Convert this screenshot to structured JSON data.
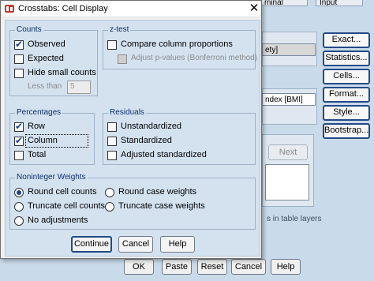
{
  "background": {
    "tabs": [
      "minal",
      "Input"
    ],
    "var_field_top": "ety]",
    "var_field_bottom": "ndex [BMI]",
    "side_buttons": [
      "Exact...",
      "Statistics...",
      "Cells...",
      "Format...",
      "Style...",
      "Bootstrap..."
    ],
    "next_label": "Next",
    "layers_text": "s in table layers",
    "bottom_buttons": [
      "OK",
      "Paste",
      "Reset",
      "Cancel",
      "Help"
    ]
  },
  "dialog": {
    "title": "Crosstabs: Cell Display",
    "close_symbol": "✕",
    "counts": {
      "legend": "Counts",
      "observed": {
        "label": "Observed",
        "checked": true
      },
      "expected": {
        "label": "Expected",
        "checked": false
      },
      "hide_small": {
        "label": "Hide small counts",
        "checked": false
      },
      "less_than_label": "Less than",
      "less_than_value": "5"
    },
    "ztest": {
      "legend": "z-test",
      "compare": {
        "label": "Compare column proportions",
        "checked": false
      },
      "adjust": {
        "label": "Adjust p-values (Bonferroni method)",
        "checked": false
      }
    },
    "percentages": {
      "legend": "Percentages",
      "row": {
        "label": "Row",
        "checked": true
      },
      "column": {
        "label": "Column",
        "checked": true
      },
      "total": {
        "label": "Total",
        "checked": false
      }
    },
    "residuals": {
      "legend": "Residuals",
      "unstandardized": {
        "label": "Unstandardized",
        "checked": false
      },
      "standardized": {
        "label": "Standardized",
        "checked": false
      },
      "adjusted": {
        "label": "Adjusted standardized",
        "checked": false
      }
    },
    "weights": {
      "legend": "Noninteger Weights",
      "selected": "Round cell counts",
      "options": [
        "Round cell counts",
        "Round case weights",
        "Truncate cell counts",
        "Truncate case weights",
        "No adjustments"
      ]
    },
    "buttons": {
      "continue": "Continue",
      "cancel": "Cancel",
      "help": "Help"
    }
  },
  "colors": {
    "legend": "#0b2f6b",
    "panel": "#d4e2f0",
    "check": "#1c3f8c"
  }
}
